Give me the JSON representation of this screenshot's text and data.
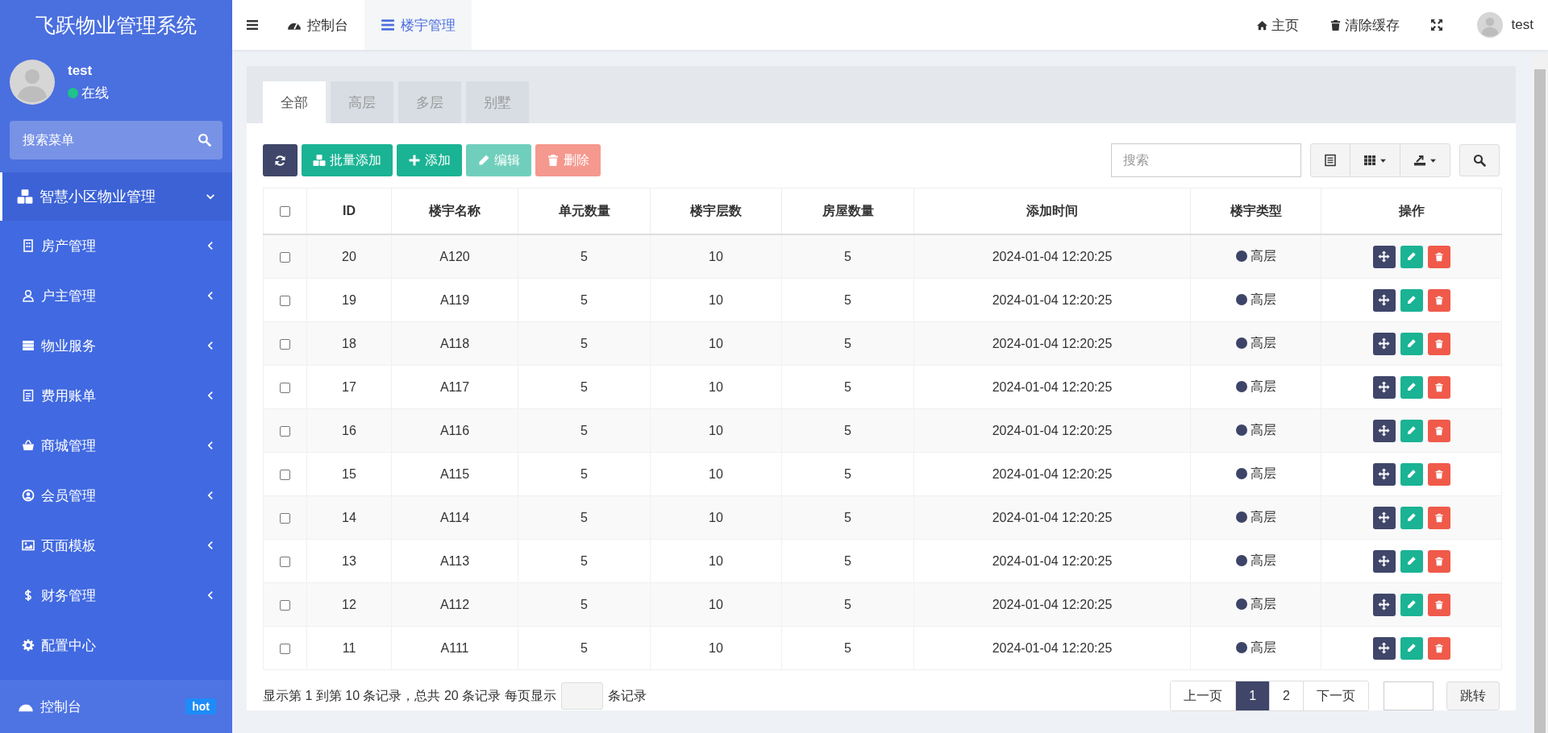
{
  "sidebar": {
    "title": "飞跃物业管理系统",
    "user": {
      "name": "test",
      "status": "在线",
      "online": true
    },
    "search": {
      "placeholder": "搜索菜单"
    },
    "menu": [
      {
        "label": "智慧小区物业管理",
        "kind": "submenu",
        "expanded": true,
        "selected": true,
        "children": [
          {
            "label": "房产管理",
            "kind": "submenu",
            "expanded": false,
            "selected": false
          },
          {
            "label": "户主管理",
            "kind": "submenu",
            "expanded": false,
            "selected": false
          },
          {
            "label": "物业服务",
            "kind": "submenu",
            "expanded": false,
            "selected": false
          },
          {
            "label": "费用账单",
            "kind": "submenu",
            "expanded": false,
            "selected": false
          },
          {
            "label": "商城管理",
            "kind": "submenu",
            "expanded": false,
            "selected": false
          },
          {
            "label": "会员管理",
            "kind": "submenu",
            "expanded": false,
            "selected": false
          },
          {
            "label": "页面模板",
            "kind": "submenu",
            "expanded": false,
            "selected": false
          },
          {
            "label": "财务管理",
            "kind": "submenu",
            "expanded": false,
            "selected": false
          },
          {
            "label": "配置中心",
            "kind": "link",
            "selected": false
          }
        ]
      }
    ],
    "bottom_item": {
      "label": "控制台",
      "badge": "hot"
    }
  },
  "header": {
    "tabs": [
      {
        "label": "控制台",
        "selected": false
      },
      {
        "label": "楼宇管理",
        "selected": true
      }
    ],
    "links": [
      "主页",
      "清除缓存"
    ],
    "user": "test"
  },
  "content": {
    "tabs": [
      {
        "label": "全部",
        "selected": true
      },
      {
        "label": "高层",
        "selected": false
      },
      {
        "label": "多层",
        "selected": false
      },
      {
        "label": "别墅",
        "selected": false
      }
    ],
    "toolbar": {
      "buttons": [
        {
          "kind": "refresh",
          "disabled": false
        },
        {
          "kind": "batch-add",
          "label": "批量添加",
          "disabled": false
        },
        {
          "kind": "add",
          "label": "添加",
          "disabled": false
        },
        {
          "kind": "edit",
          "label": "编辑",
          "disabled": true
        },
        {
          "kind": "delete",
          "label": "删除",
          "disabled": true
        }
      ],
      "search": {
        "placeholder": "搜索"
      }
    },
    "table": {
      "select_all": {
        "checked": false
      },
      "columns": [
        "ID",
        "楼宇名称",
        "单元数量",
        "楼宇层数",
        "房屋数量",
        "添加时间",
        "楼宇类型",
        "操作"
      ],
      "rows": [
        {
          "checked": false,
          "cells": [
            "20",
            "A120",
            "5",
            "10",
            "5",
            "2024-01-04 12:20:25",
            "高层"
          ]
        },
        {
          "checked": false,
          "cells": [
            "19",
            "A119",
            "5",
            "10",
            "5",
            "2024-01-04 12:20:25",
            "高层"
          ]
        },
        {
          "checked": false,
          "cells": [
            "18",
            "A118",
            "5",
            "10",
            "5",
            "2024-01-04 12:20:25",
            "高层"
          ]
        },
        {
          "checked": false,
          "cells": [
            "17",
            "A117",
            "5",
            "10",
            "5",
            "2024-01-04 12:20:25",
            "高层"
          ]
        },
        {
          "checked": false,
          "cells": [
            "16",
            "A116",
            "5",
            "10",
            "5",
            "2024-01-04 12:20:25",
            "高层"
          ]
        },
        {
          "checked": false,
          "cells": [
            "15",
            "A115",
            "5",
            "10",
            "5",
            "2024-01-04 12:20:25",
            "高层"
          ]
        },
        {
          "checked": false,
          "cells": [
            "14",
            "A114",
            "5",
            "10",
            "5",
            "2024-01-04 12:20:25",
            "高层"
          ]
        },
        {
          "checked": false,
          "cells": [
            "13",
            "A113",
            "5",
            "10",
            "5",
            "2024-01-04 12:20:25",
            "高层"
          ]
        },
        {
          "checked": false,
          "cells": [
            "12",
            "A112",
            "5",
            "10",
            "5",
            "2024-01-04 12:20:25",
            "高层"
          ]
        },
        {
          "checked": false,
          "cells": [
            "11",
            "A111",
            "5",
            "10",
            "5",
            "2024-01-04 12:20:25",
            "高层"
          ]
        }
      ]
    },
    "footer": {
      "summary": "显示第 1 到第 10 条记录，总共 20 条记录 每页显示",
      "suffix": "条记录",
      "pages": [
        {
          "label": "上一页",
          "selected": false
        },
        {
          "label": "1",
          "selected": true
        },
        {
          "label": "2",
          "selected": false
        },
        {
          "label": "下一页",
          "selected": false
        }
      ],
      "jump": "跳转"
    }
  }
}
